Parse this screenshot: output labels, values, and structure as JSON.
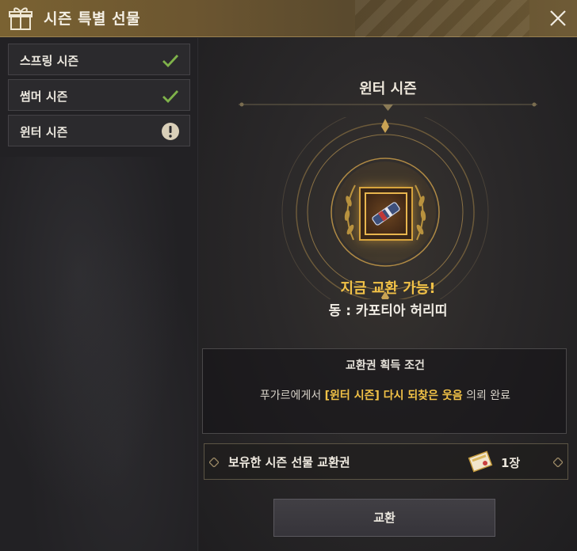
{
  "window": {
    "title": "시즌 특별 선물",
    "icons": {
      "gift": "gift-icon",
      "close": "close-icon"
    }
  },
  "sidebar": {
    "items": [
      {
        "label": "스프링 시즌",
        "status": "completed",
        "status_icon": "check-icon"
      },
      {
        "label": "썸머 시즌",
        "status": "completed",
        "status_icon": "check-icon"
      },
      {
        "label": "윈터 시즌",
        "status": "attention",
        "status_icon": "exclamation-icon"
      }
    ]
  },
  "main": {
    "season_title": "윈터 시즌",
    "exchange_status": "지금 교환 가능!",
    "reward_name": "동 : 카포티아 허리띠",
    "condition": {
      "title": "교환권 획득 조건",
      "prefix": "푸가르에게서",
      "quest": "[윈터 시즌] 다시 되찾은 웃음",
      "suffix": "의뢰 완료"
    },
    "ticket": {
      "label": "보유한 시즌 선물 교환권",
      "count": "1장"
    },
    "exchange_button": "교환"
  },
  "colors": {
    "accent_gold": "#f2c247",
    "check_green": "#7fb24a",
    "title_bar": "#7a6232",
    "panel_bg": "#232225"
  }
}
